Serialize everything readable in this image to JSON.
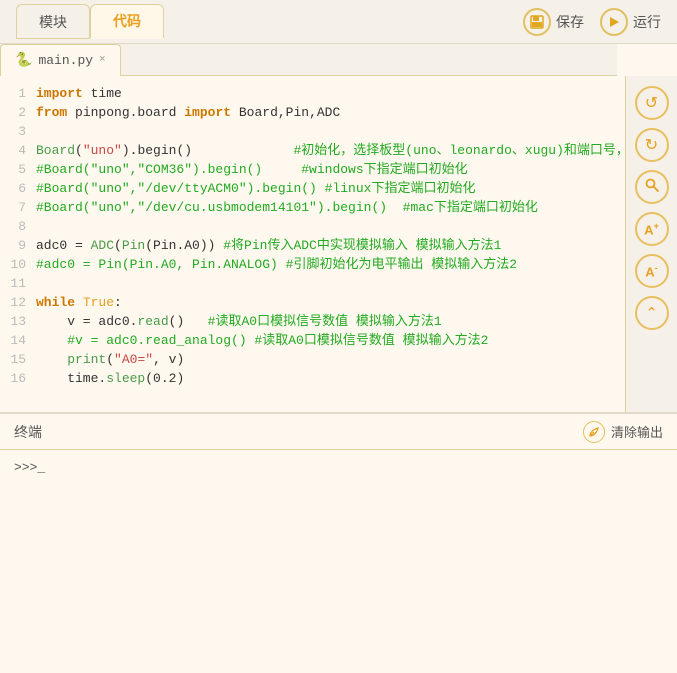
{
  "toolbar": {
    "tab_module": "模块",
    "tab_code": "代码",
    "save_label": "保存",
    "run_label": "运行"
  },
  "editor": {
    "file_tab": {
      "name": "main.py",
      "close": "×"
    },
    "lines": [
      {
        "num": 1,
        "code": "import_time"
      },
      {
        "num": 2,
        "code": "from_pinpong"
      },
      {
        "num": 3,
        "code": ""
      },
      {
        "num": 4,
        "code": "board_uno"
      },
      {
        "num": 5,
        "code": "board_uno_com36"
      },
      {
        "num": 6,
        "code": "board_uno_tty"
      },
      {
        "num": 7,
        "code": "board_uno_dev"
      },
      {
        "num": 8,
        "code": ""
      },
      {
        "num": 9,
        "code": "adc0_assign"
      },
      {
        "num": 10,
        "code": "adc0_comment"
      },
      {
        "num": 11,
        "code": ""
      },
      {
        "num": 12,
        "code": "while_true"
      },
      {
        "num": 13,
        "code": "v_read"
      },
      {
        "num": 14,
        "code": "v_read_analog"
      },
      {
        "num": 15,
        "code": "print_a0"
      },
      {
        "num": 16,
        "code": "sleep"
      }
    ]
  },
  "side_toolbar": {
    "undo_label": "↺",
    "redo_label": "↻",
    "search_label": "🔍",
    "font_up_label": "A+",
    "font_down_label": "A-",
    "collapse_label": "≪"
  },
  "terminal": {
    "title": "终端",
    "clear_label": "清除输出",
    "prompt": ">>>_"
  }
}
